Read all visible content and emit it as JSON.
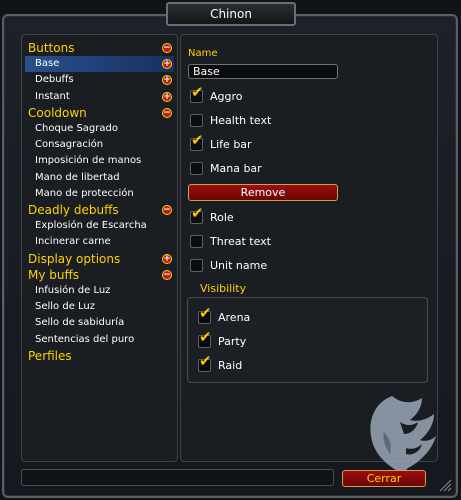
{
  "window": {
    "title": "Chinon"
  },
  "tree": [
    {
      "label": "Buttons",
      "type": "group",
      "toggle": "−"
    },
    {
      "label": "Base",
      "type": "child",
      "toggle": "+",
      "selected": true
    },
    {
      "label": "Debuffs",
      "type": "child",
      "toggle": "+"
    },
    {
      "label": "Instant",
      "type": "child",
      "toggle": "+"
    },
    {
      "label": "Cooldown",
      "type": "group",
      "toggle": "−"
    },
    {
      "label": "Choque Sagrado",
      "type": "child"
    },
    {
      "label": "Consagración",
      "type": "child"
    },
    {
      "label": "Imposición de manos",
      "type": "child"
    },
    {
      "label": "Mano de libertad",
      "type": "child"
    },
    {
      "label": "Mano de protección",
      "type": "child"
    },
    {
      "label": "Deadly debuffs",
      "type": "group",
      "toggle": "−"
    },
    {
      "label": "Explosión de Escarcha",
      "type": "child"
    },
    {
      "label": "Incinerar carne",
      "type": "child"
    },
    {
      "label": "Display options",
      "type": "group",
      "toggle": "+"
    },
    {
      "label": "My buffs",
      "type": "group",
      "toggle": "−"
    },
    {
      "label": "Infusión de Luz",
      "type": "child"
    },
    {
      "label": "Sello de Luz",
      "type": "child"
    },
    {
      "label": "Sello de sabiduría",
      "type": "child"
    },
    {
      "label": "Sentencias del puro",
      "type": "child"
    },
    {
      "label": "Perfiles",
      "type": "group"
    }
  ],
  "settings": {
    "name_label": "Name",
    "name_value": "Base",
    "remove_label": "Remove",
    "visibility_label": "Visibility",
    "options": [
      {
        "label": "Aggro",
        "checked": true
      },
      {
        "label": "Health text",
        "checked": false
      },
      {
        "label": "Life bar",
        "checked": true
      },
      {
        "label": "Mana bar",
        "checked": false
      },
      {
        "label": "Role",
        "checked": true
      },
      {
        "label": "Threat text",
        "checked": false
      },
      {
        "label": "Unit name",
        "checked": false
      }
    ],
    "visibility": [
      {
        "label": "Arena",
        "checked": true
      },
      {
        "label": "Party",
        "checked": true
      },
      {
        "label": "Raid",
        "checked": true
      }
    ]
  },
  "footer": {
    "close_label": "Cerrar"
  },
  "icons": {
    "emblem": "lion-head-emblem",
    "resize": "resize-grip-icon",
    "check": "check-icon"
  },
  "colors": {
    "gold": "#ffd200",
    "selection": "#2b4f8c",
    "button_red": "#8a0a0a"
  }
}
